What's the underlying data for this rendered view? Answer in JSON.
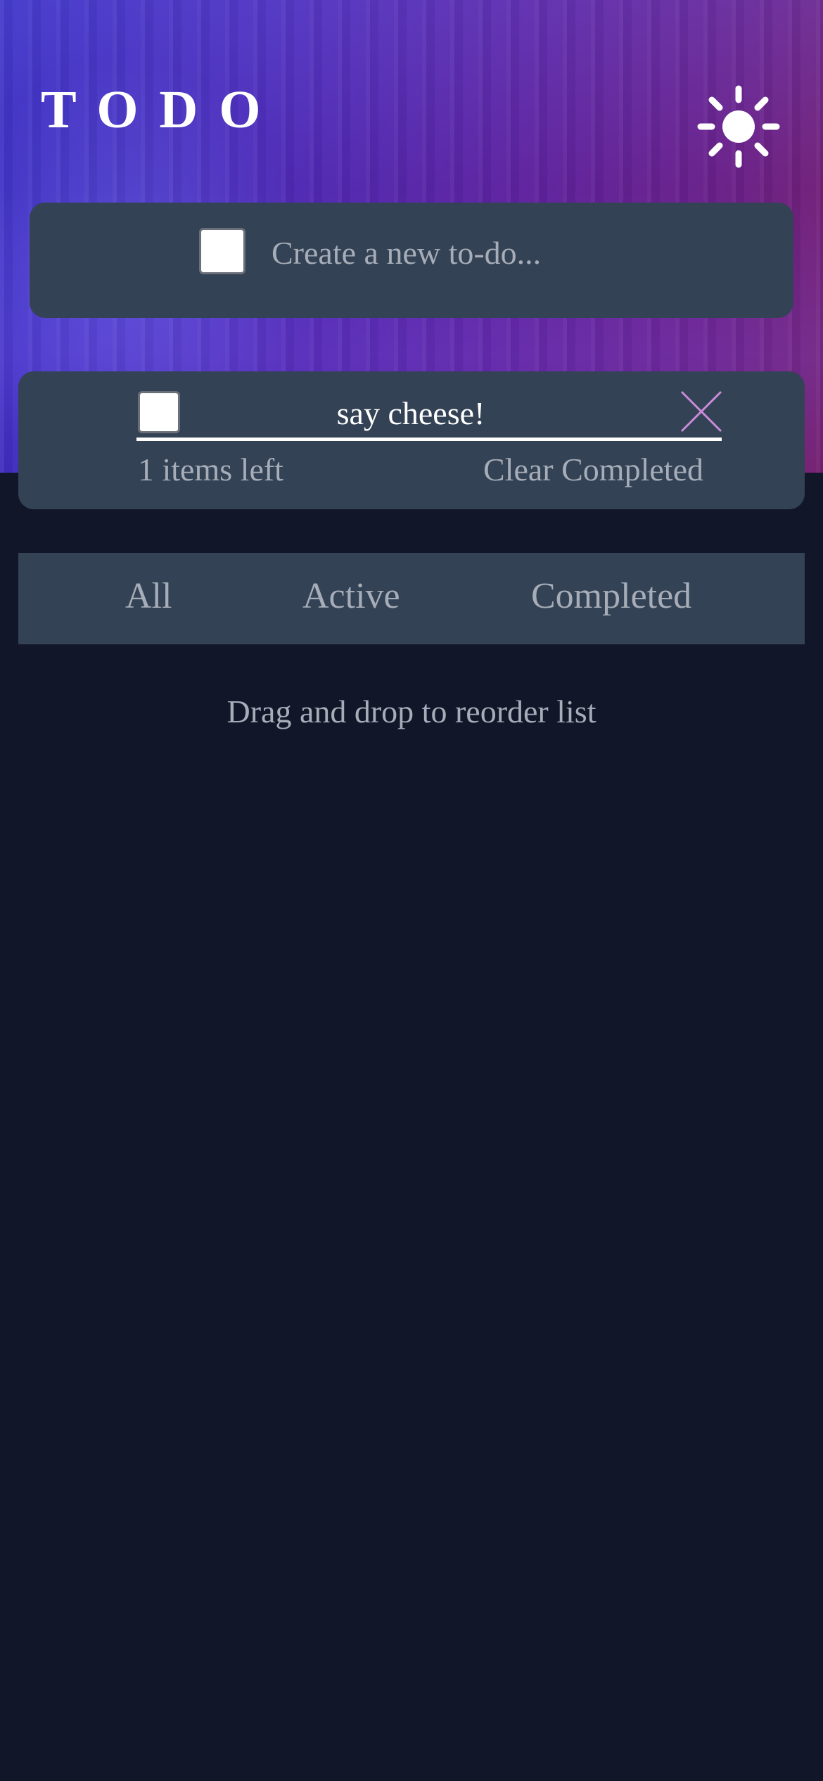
{
  "header": {
    "title": "TODO",
    "theme_icon": "sun-icon"
  },
  "new_todo": {
    "placeholder": "Create a new to-do..."
  },
  "todos": [
    {
      "text": "say cheese!",
      "completed": false,
      "delete_icon": "close-icon"
    }
  ],
  "footer": {
    "items_left": "1 items left",
    "clear_completed": "Clear Completed"
  },
  "filters": {
    "all": "All",
    "active": "Active",
    "completed": "Completed"
  },
  "hint": "Drag and drop to reorder list",
  "colors": {
    "background": "#111729",
    "card": "#334254",
    "muted_text": "#a6adb8",
    "delete_accent": "#c98bd9",
    "hero_start": "#3b2fc2",
    "hero_end": "#74206f"
  }
}
